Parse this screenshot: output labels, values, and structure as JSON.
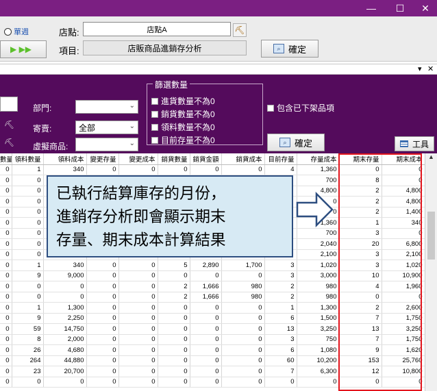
{
  "window": {
    "minimize_glyph": "—",
    "maximize_glyph": "☐",
    "close_glyph": "✕"
  },
  "top": {
    "radio_label": "單週",
    "store_label": "店點:",
    "store_value": "店點A",
    "item_label": "項目:",
    "item_value": "店販商品進銷存分析",
    "confirm_label": "確定",
    "nav_glyphs": "▶ ▶▶"
  },
  "strip": {
    "dropdown_glyph": "▾",
    "close_glyph": "✕"
  },
  "filters": {
    "dept_label": "部門:",
    "consign_label": "寄賣:",
    "consign_value": "全部",
    "virtual_label": "虛擬商品:",
    "group_title": "篩選數量",
    "checks": [
      "進貨數量不為0",
      "銷貨數量不為0",
      "領料數量不為0",
      "目前存量不為0"
    ],
    "include_delisted": "包含已下架品項",
    "confirm_label": "確定",
    "tools_label": "工具"
  },
  "table": {
    "headers": [
      "數量",
      "領料數量",
      "領料成本",
      "變更存量",
      "變更成本",
      "銷貨數量",
      "銷貨金額",
      "銷貨成本",
      "目前存量",
      "存量成本",
      "期末存量",
      "期末成本"
    ],
    "rows": [
      [
        "0",
        "1",
        "340",
        "0",
        "0",
        "0",
        "0",
        "0",
        "4",
        "1,360",
        "0",
        "0"
      ],
      [
        "0",
        "0",
        "",
        "",
        "",
        "",
        "",
        "",
        "",
        "700",
        "8",
        "0"
      ],
      [
        "0",
        "0",
        "",
        "",
        "",
        "",
        "",
        "",
        "",
        "4,800",
        "2",
        "4,800"
      ],
      [
        "0",
        "0",
        "",
        "",
        "",
        "",
        "",
        "",
        "",
        "0",
        "2",
        "4,800"
      ],
      [
        "0",
        "0",
        "",
        "",
        "",
        "",
        "",
        "",
        "",
        "0",
        "2",
        "1,400"
      ],
      [
        "0",
        "0",
        "",
        "",
        "",
        "",
        "",
        "",
        "",
        "1,360",
        "1",
        "340"
      ],
      [
        "0",
        "0",
        "",
        "",
        "",
        "",
        "",
        "",
        "",
        "700",
        "3",
        "0"
      ],
      [
        "0",
        "0",
        "",
        "",
        "",
        "",
        "",
        "",
        "",
        "2,040",
        "20",
        "6,800"
      ],
      [
        "0",
        "0",
        "",
        "",
        "",
        "",
        "",
        "",
        "",
        "2,100",
        "3",
        "2,100"
      ],
      [
        "0",
        "1",
        "340",
        "0",
        "0",
        "5",
        "2,890",
        "1,700",
        "3",
        "1,020",
        "3",
        "1,020"
      ],
      [
        "0",
        "9",
        "9,000",
        "0",
        "0",
        "0",
        "0",
        "0",
        "3",
        "3,000",
        "10",
        "10,900"
      ],
      [
        "0",
        "0",
        "0",
        "0",
        "0",
        "2",
        "1,666",
        "980",
        "2",
        "980",
        "4",
        "1,960"
      ],
      [
        "0",
        "0",
        "0",
        "0",
        "0",
        "2",
        "1,666",
        "980",
        "2",
        "980",
        "0",
        "0"
      ],
      [
        "0",
        "1",
        "1,300",
        "0",
        "0",
        "0",
        "0",
        "0",
        "1",
        "1,300",
        "2",
        "2,600"
      ],
      [
        "0",
        "9",
        "2,250",
        "0",
        "0",
        "0",
        "0",
        "0",
        "6",
        "1,500",
        "7",
        "1,750"
      ],
      [
        "0",
        "59",
        "14,750",
        "0",
        "0",
        "0",
        "0",
        "0",
        "13",
        "3,250",
        "13",
        "3,250"
      ],
      [
        "0",
        "8",
        "2,000",
        "0",
        "0",
        "0",
        "0",
        "0",
        "3",
        "750",
        "7",
        "1,750"
      ],
      [
        "0",
        "26",
        "4,680",
        "0",
        "0",
        "0",
        "0",
        "0",
        "6",
        "1,080",
        "9",
        "1,620"
      ],
      [
        "0",
        "264",
        "44,880",
        "0",
        "0",
        "0",
        "0",
        "0",
        "60",
        "10,200",
        "153",
        "25,760"
      ],
      [
        "0",
        "23",
        "20,700",
        "0",
        "0",
        "0",
        "0",
        "0",
        "7",
        "6,300",
        "12",
        "10,800"
      ],
      [
        "0",
        "0",
        "0",
        "0",
        "0",
        "0",
        "0",
        "0",
        "0",
        "0",
        "0",
        "0"
      ]
    ]
  },
  "callout": {
    "line1": "已執行結算庫存的月份，",
    "line2": "進銷存分析即會顯示期末",
    "line3": "存量、期末成本計算結果"
  },
  "colors": {
    "titlebar": "#7b1f82",
    "panel": "#540b5c",
    "highlight": "#e3141c",
    "callout_bg": "#d7eaf4",
    "callout_border": "#2d4e80"
  }
}
